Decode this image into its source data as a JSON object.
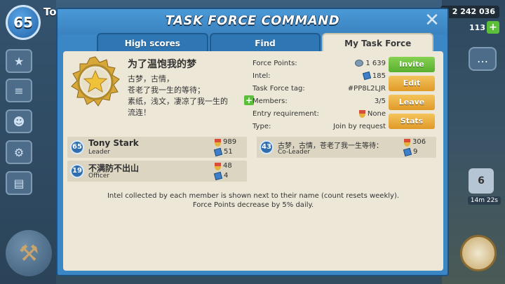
{
  "hud": {
    "player_level": "65",
    "player_name_peek": "To",
    "resource_amount": "2 242 036",
    "gem_count": "113",
    "notification_count": "6",
    "timer": "14m 22s"
  },
  "dialog": {
    "title": "TASK FORCE COMMAND",
    "tabs": [
      "High scores",
      "Find",
      "My Task Force"
    ]
  },
  "task_force": {
    "name": "为了温饱我的梦",
    "description": [
      "古梦，古情，",
      "苍老了我一生的等待；",
      "素纸，浅文，凄凉了我一生的",
      "流连！"
    ],
    "info": {
      "force_points_label": "Force Points:",
      "force_points": "1 639",
      "intel_label": "Intel:",
      "intel": "185",
      "tag_label": "Task Force tag:",
      "tag": "#PP8L2LJR",
      "members_label": "Members:",
      "members": "3/5",
      "entry_label": "Entry requirement:",
      "entry": "None",
      "type_label": "Type:",
      "type": "Join by request"
    }
  },
  "actions": {
    "invite": "Invite",
    "edit": "Edit",
    "leave": "Leave",
    "stats": "Stats"
  },
  "members": [
    {
      "level": "65",
      "name": "Tony Stark",
      "role": "Leader",
      "medals": "989",
      "intel": "51"
    },
    {
      "level": "43",
      "name": "古梦，古情，苍老了我一生等待：",
      "role": "Co-Leader",
      "medals": "306",
      "intel": "9"
    },
    {
      "level": "19",
      "name": "不满防不出山",
      "role": "Officer",
      "medals": "48",
      "intel": "4"
    }
  ],
  "footer": {
    "line1": "Intel collected by each member is shown next to their name (count resets weekly).",
    "line2": "Force Points decrease by 5% daily."
  },
  "colors": {
    "panel_blue": "#3b87c6",
    "content_bg": "#ece7d7",
    "invite_green": "#5aae2e",
    "action_orange": "#e09a28"
  }
}
